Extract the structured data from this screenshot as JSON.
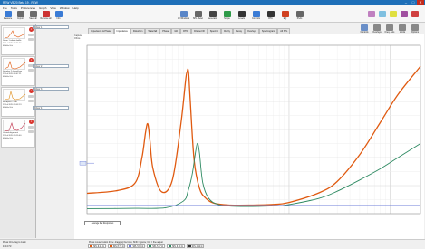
{
  "window": {
    "title": "REW V5.20 Beta 19 - REW"
  },
  "menu": [
    "File",
    "Tools",
    "Preferences",
    "Graph",
    "View",
    "Window",
    "Help"
  ],
  "toolbar_left": [
    {
      "label": "Measure",
      "color": "#3a7bd5"
    },
    {
      "label": "Import",
      "color": "#6a6a6a"
    },
    {
      "label": "Save all",
      "color": "#6a6a6a"
    },
    {
      "label": "Remove all",
      "color": "#c33"
    },
    {
      "label": "Info",
      "color": "#3a7bd5"
    }
  ],
  "toolbar_center": [
    {
      "label": "All Windows",
      "color": "#5a86c8"
    },
    {
      "label": "SPL Meter",
      "color": "#666"
    },
    {
      "label": "Generator",
      "color": "#444"
    },
    {
      "label": "Scope",
      "color": "#2e9a48"
    },
    {
      "label": "Levels",
      "color": "#333"
    },
    {
      "label": "Controls",
      "color": "#3a7bd5"
    },
    {
      "label": "RTA",
      "color": "#333"
    },
    {
      "label": "EQ",
      "color": "#d04020"
    },
    {
      "label": "Prefs",
      "color": "#666"
    }
  ],
  "toolbar_right_colors": [
    "#c080c0",
    "#80c0e0",
    "#e0e040",
    "#a050a0",
    "#d04040"
  ],
  "measurements": [
    {
      "name": "Driver 1",
      "info": [
        "Driver 1 infinite baffle",
        "23 Jul 2020 18:34:56",
        "48 kHz 2ch",
        "Avg 96 dB"
      ]
    },
    {
      "name": "Driver 2",
      "info": [
        "Speaker 2 closed box",
        "23 Jul 2020 18:47:21",
        "48 kHz 2ch",
        "Avg 92 dB"
      ]
    },
    {
      "name": "Driver 3",
      "info": [
        "Bandpass 2 cab",
        "23 Jul 2020 19:02:13",
        "48 kHz 2ch",
        "Avg 90 dB"
      ]
    },
    {
      "name": "Driver 4",
      "info": [
        "Vented alignment",
        "23 Jul 2020 19:15:40",
        "48 kHz 2ch",
        "Avg 88 dB"
      ]
    }
  ],
  "tabs": [
    "Impedance & Phase",
    "Impedance",
    "Distortion",
    "Waterfall",
    "Phase",
    "GD",
    "RT60",
    "Filtered IR",
    "Spectral",
    "Clarity",
    "Decay",
    "Overlays",
    "Spectrogram",
    "All SPL"
  ],
  "active_tab": 1,
  "right_tools": [
    "Controls",
    "Overlays",
    "Freq. Axis",
    "Limits",
    "Options"
  ],
  "graph": {
    "left_panel": [
      "Capture",
      "Ohms"
    ],
    "y_label": "Ohm",
    "x_label": "Hz",
    "xlim": [
      10,
      20000
    ],
    "ylim": [
      0,
      120
    ],
    "log_x": true,
    "grid": true,
    "avg_button": "Average the Responses"
  },
  "chart_data": {
    "type": "line",
    "title": "",
    "xlabel": "",
    "ylabel": "",
    "log_x": true,
    "xlim": [
      10,
      20000
    ],
    "ylim": [
      0,
      120
    ],
    "series": [
      {
        "color": "#e05a10",
        "x": [
          10,
          20,
          30,
          35,
          38,
          40,
          42,
          45,
          55,
          70,
          85,
          95,
          98,
          100,
          102,
          105,
          115,
          130,
          150,
          180,
          250,
          400,
          700,
          1000,
          2000,
          3000,
          5000,
          8000,
          12000,
          20000
        ],
        "y": [
          14.5,
          16.5,
          22,
          40,
          58,
          64,
          52,
          32,
          15.5,
          24,
          64,
          96,
          101,
          103,
          98,
          82,
          38,
          18,
          11,
          7.5,
          6.2,
          6.1,
          6.6,
          8,
          15,
          23,
          42,
          65,
          85,
          105
        ]
      },
      {
        "color": "#2e8a62",
        "x": [
          10,
          30,
          60,
          90,
          100,
          110,
          120,
          125,
          130,
          140,
          160,
          200,
          300,
          700,
          1000,
          2000,
          3000,
          5000,
          8000,
          12000,
          20000
        ],
        "y": [
          3.6,
          3.8,
          4.2,
          9,
          16,
          28,
          46,
          50,
          43,
          22,
          11,
          6.5,
          5.2,
          5.5,
          6.5,
          11,
          16,
          24,
          32,
          40,
          50
        ]
      },
      {
        "color": "#6c7cd8",
        "x": [
          10,
          20000
        ],
        "y": [
          5.8,
          5.8
        ]
      }
    ]
  },
  "status": {
    "line1": "Press Ctrl+drag to zoom",
    "line2": "Press mouse button there: dragging the lines; Shift = ignore; Ctrl = fine adjust",
    "line3": "474.0 Hz"
  },
  "cursors": [
    {
      "label": "SPL",
      "value": "9.21 Ω",
      "color": "#e05a10"
    },
    {
      "label": "SPL",
      "value": "8.71 Ω",
      "color": "#e05a10"
    },
    {
      "label": "SPL",
      "value": "5.90 Ω",
      "color": "#6c7cd8"
    },
    {
      "label": "SPL",
      "value": "5.47 Ω",
      "color": "#2e8a62"
    },
    {
      "label": "SPL",
      "value": "6.10 Ω",
      "color": "#2e8a62"
    },
    {
      "label": "SPL",
      "value": "4.12 Ω",
      "color": "#333"
    }
  ]
}
